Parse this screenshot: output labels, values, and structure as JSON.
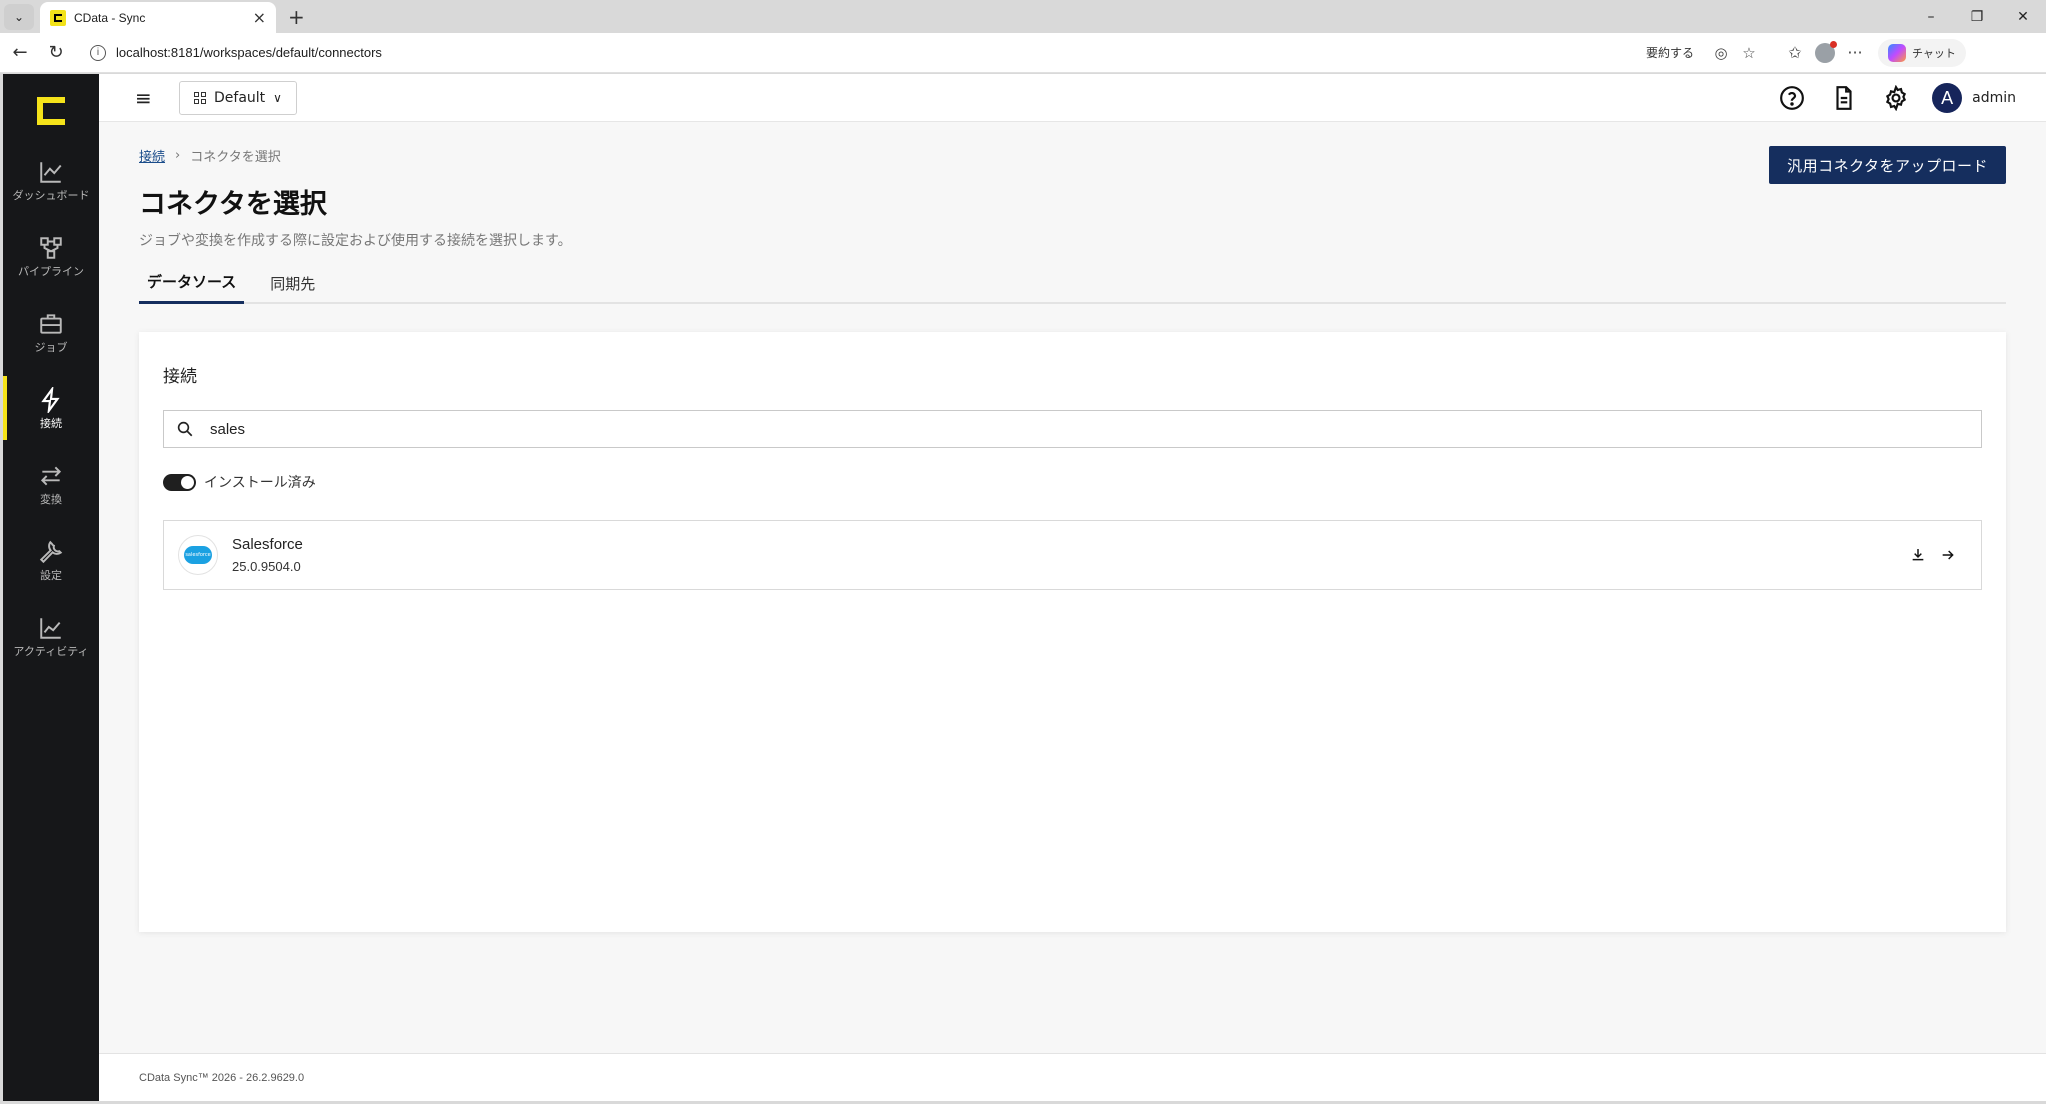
{
  "browser": {
    "tab_title": "CData - Sync",
    "url": "localhost:8181/workspaces/default/connectors",
    "summarize_label": "要約する",
    "copilot_label": "チャット"
  },
  "sidebar": {
    "items": [
      {
        "label": "ダッシュボード",
        "icon": "chart-line-icon",
        "active": false
      },
      {
        "label": "パイプライン",
        "icon": "pipeline-icon",
        "active": false
      },
      {
        "label": "ジョブ",
        "icon": "briefcase-icon",
        "active": false
      },
      {
        "label": "接続",
        "icon": "lightning-icon",
        "active": true
      },
      {
        "label": "変換",
        "icon": "arrows-swap-icon",
        "active": false
      },
      {
        "label": "設定",
        "icon": "wrench-icon",
        "active": false
      },
      {
        "label": "アクティビティ",
        "icon": "activity-icon",
        "active": false
      }
    ],
    "accent_color": "#f5e31a"
  },
  "topbar": {
    "workspace": "Default",
    "user": "admin",
    "user_initial": "A"
  },
  "page": {
    "breadcrumb_link": "接続",
    "breadcrumb_current": "コネクタを選択",
    "title": "コネクタを選択",
    "description": "ジョブや変換を作成する際に設定および使用する接続を選択します。",
    "upload_button": "汎用コネクタをアップロード",
    "tabs": [
      {
        "label": "データソース",
        "active": true
      },
      {
        "label": "同期先",
        "active": false
      }
    ]
  },
  "card": {
    "title": "接続",
    "search_value": "sales",
    "toggle_label": "インストール済み",
    "toggle_on": true,
    "connectors": [
      {
        "name": "Salesforce",
        "version": "25.0.9504.0",
        "logo_text": "salesforce"
      }
    ]
  },
  "footer": {
    "text": "CData Sync™ 2026 - 26.2.9629.0"
  },
  "colors": {
    "primary": "#152e5e",
    "sidebar_bg": "#161719"
  }
}
